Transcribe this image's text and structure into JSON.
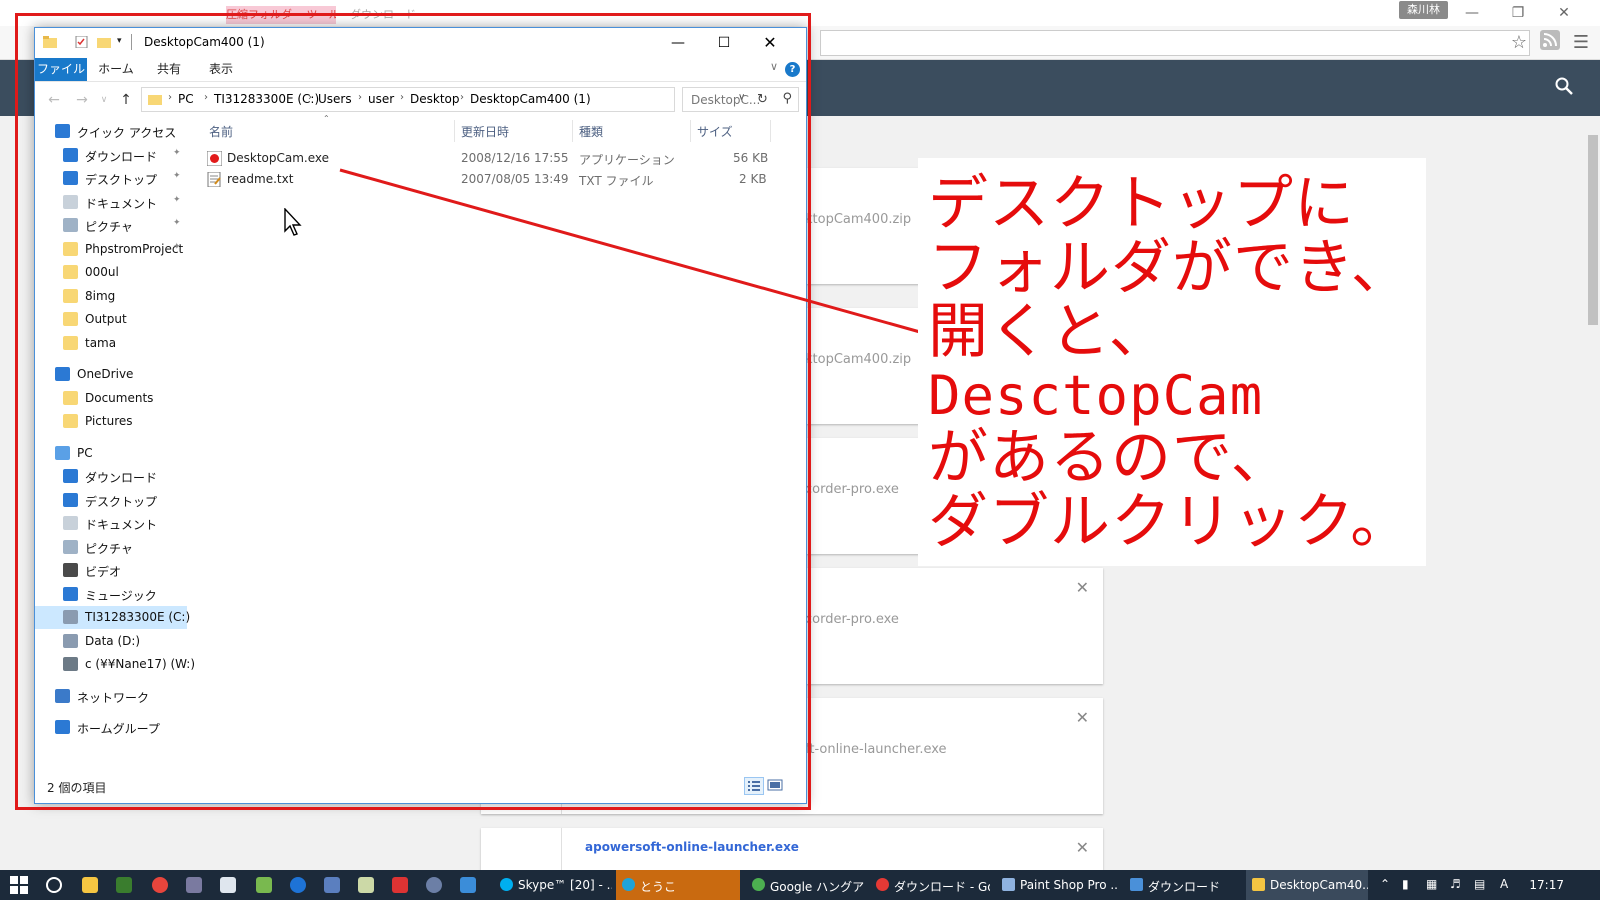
{
  "browser": {
    "user_name": "森川林",
    "back_tab_label": "圧縮フォルダー ツール",
    "back_tab2_label": "ダウンロード",
    "downloads": [
      {
        "name": "ktopCam400.zip"
      },
      {
        "name": "ktopCam400.zip"
      },
      {
        "name": "corder-pro.exe"
      },
      {
        "name": "corder-pro.exe"
      },
      {
        "name": "ft-online-launcher.exe"
      },
      {
        "name": "apowersoft-online-launcher.exe"
      }
    ]
  },
  "explorer": {
    "title": "DesktopCam400 (1)",
    "ribbon_tabs": [
      "ファイル",
      "ホーム",
      "共有",
      "表示"
    ],
    "help_label": "?",
    "breadcrumb": [
      "PC",
      "TI31283300E (C:)",
      "Users",
      "user",
      "Desktop",
      "DesktopCam400 (1)"
    ],
    "search_placeholder": "DesktopC...",
    "nav_items": [
      {
        "label": "クイック アクセス",
        "icon": "star-icon",
        "pinned": false
      },
      {
        "label": "ダウンロード",
        "icon": "download-arrow-icon",
        "pinned": true
      },
      {
        "label": "デスクトップ",
        "icon": "desktop-icon",
        "pinned": true
      },
      {
        "label": "ドキュメント",
        "icon": "document-icon",
        "pinned": true
      },
      {
        "label": "ピクチャ",
        "icon": "pictures-icon",
        "pinned": true
      },
      {
        "label": "PhpstromProject",
        "icon": "folder-icon",
        "pinned": true
      },
      {
        "label": "000ul",
        "icon": "folder-icon",
        "pinned": false
      },
      {
        "label": "8img",
        "icon": "folder-icon",
        "pinned": false
      },
      {
        "label": "Output",
        "icon": "folder-icon",
        "pinned": false
      },
      {
        "label": "tama",
        "icon": "folder-icon",
        "pinned": false
      },
      {
        "label": "OneDrive",
        "icon": "onedrive-icon",
        "pinned": false
      },
      {
        "label": "Documents",
        "icon": "folder-check-icon",
        "pinned": false
      },
      {
        "label": "Pictures",
        "icon": "folder-check-icon",
        "pinned": false
      },
      {
        "label": "PC",
        "icon": "pc-icon",
        "pinned": false
      },
      {
        "label": "ダウンロード",
        "icon": "download-arrow-icon",
        "pinned": false
      },
      {
        "label": "デスクトップ",
        "icon": "desktop-icon",
        "pinned": false
      },
      {
        "label": "ドキュメント",
        "icon": "document-icon",
        "pinned": false
      },
      {
        "label": "ピクチャ",
        "icon": "pictures-icon",
        "pinned": false
      },
      {
        "label": "ビデオ",
        "icon": "video-icon",
        "pinned": false
      },
      {
        "label": "ミュージック",
        "icon": "music-icon",
        "pinned": false
      },
      {
        "label": "TI31283300E (C:)",
        "icon": "drive-icon",
        "pinned": false,
        "selected": true
      },
      {
        "label": "Data (D:)",
        "icon": "drive-icon",
        "pinned": false
      },
      {
        "label": "c (¥¥Nane17) (W:)",
        "icon": "network-drive-icon",
        "pinned": false
      },
      {
        "label": "ネットワーク",
        "icon": "network-icon",
        "pinned": false
      },
      {
        "label": "ホームグループ",
        "icon": "homegroup-icon",
        "pinned": false
      }
    ],
    "columns": [
      "名前",
      "更新日時",
      "種類",
      "サイズ"
    ],
    "files": [
      {
        "name": "DesktopCam.exe",
        "date": "2008/12/16 17:55",
        "type": "アプリケーション",
        "size": "56 KB",
        "icon": "app-record-icon"
      },
      {
        "name": "readme.txt",
        "date": "2007/08/05 13:49",
        "type": "TXT ファイル",
        "size": "2 KB",
        "icon": "text-file-icon"
      }
    ],
    "status": "2 個の項目"
  },
  "annotation": {
    "lines": [
      "デスクトップに",
      "フォルダができ、",
      "開くと、",
      "DesctopCam",
      "があるので、",
      "ダブルクリック。"
    ],
    "color": "#e50c0c"
  },
  "taskbar": {
    "apps": [
      {
        "label": "Skype™ [20] - ...",
        "color": "#00aff0"
      },
      {
        "label": "とうこ",
        "color": "#1fa3d8"
      },
      {
        "label": "Google ハングア...",
        "color": "#4caf50"
      },
      {
        "label": "ダウンロード - Go...",
        "color": "#e53935"
      },
      {
        "label": "Paint Shop Pro ...",
        "color": "#8fb3e0"
      },
      {
        "label": "ダウンロード",
        "color": "#4a90d9"
      },
      {
        "label": "DesktopCam40...",
        "color": "#f4c542"
      }
    ],
    "time": "17:17"
  }
}
